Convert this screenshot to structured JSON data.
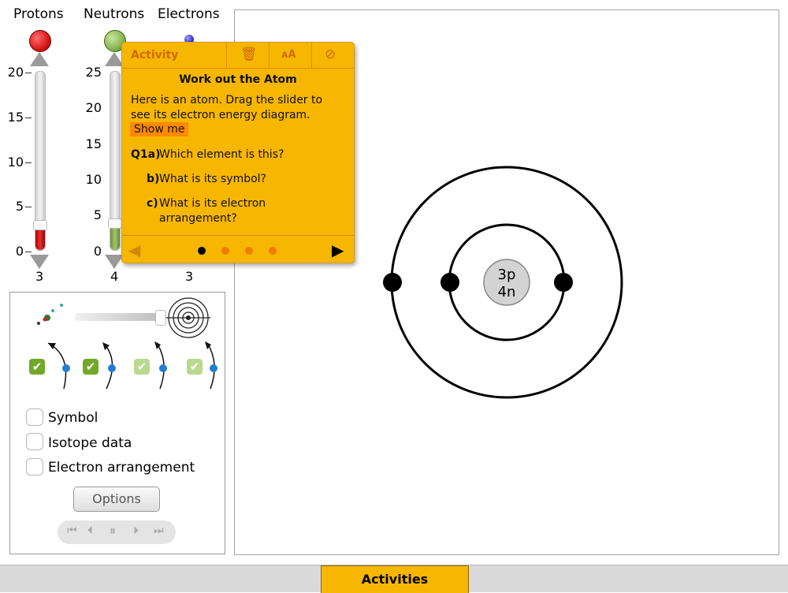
{
  "columns": {
    "protons": {
      "title": "Protons",
      "count": "3",
      "ticks": [
        "20",
        "15",
        "10",
        "5",
        "0"
      ],
      "color": "#d81818"
    },
    "neutrons": {
      "title": "Neutrons",
      "count": "4",
      "ticks": [
        "25",
        "20",
        "15",
        "10",
        "5",
        "0"
      ],
      "color": "#86b450"
    },
    "electrons": {
      "title": "Electrons",
      "count": "3",
      "color": "#3434d0"
    }
  },
  "panel": {
    "zoom_level": 1.0,
    "options": [
      {
        "label": "Symbol",
        "checked": false
      },
      {
        "label": "Isotope data",
        "checked": false
      },
      {
        "label": "Electron arrangement",
        "checked": false
      }
    ],
    "options_button": "Options"
  },
  "popup": {
    "title": "Activity",
    "heading": "Work out the Atom",
    "intro_line1": "Here is an atom. Drag the slider to",
    "intro_line2": "see its electron energy diagram.",
    "show_me": "Show me",
    "q1_prefix": "Q1a)",
    "q1_text": "Which element is this?",
    "qb_prefix": "b)",
    "qb_text": "What is its symbol?",
    "qc_prefix": "c)",
    "qc_line1": "What is its electron",
    "qc_line2": "arrangement?",
    "page_count": 4,
    "current_page": 1
  },
  "atom": {
    "nucleus_line1": "3p",
    "nucleus_line2": "4n"
  },
  "bottom": {
    "activities_label": "Activities"
  }
}
